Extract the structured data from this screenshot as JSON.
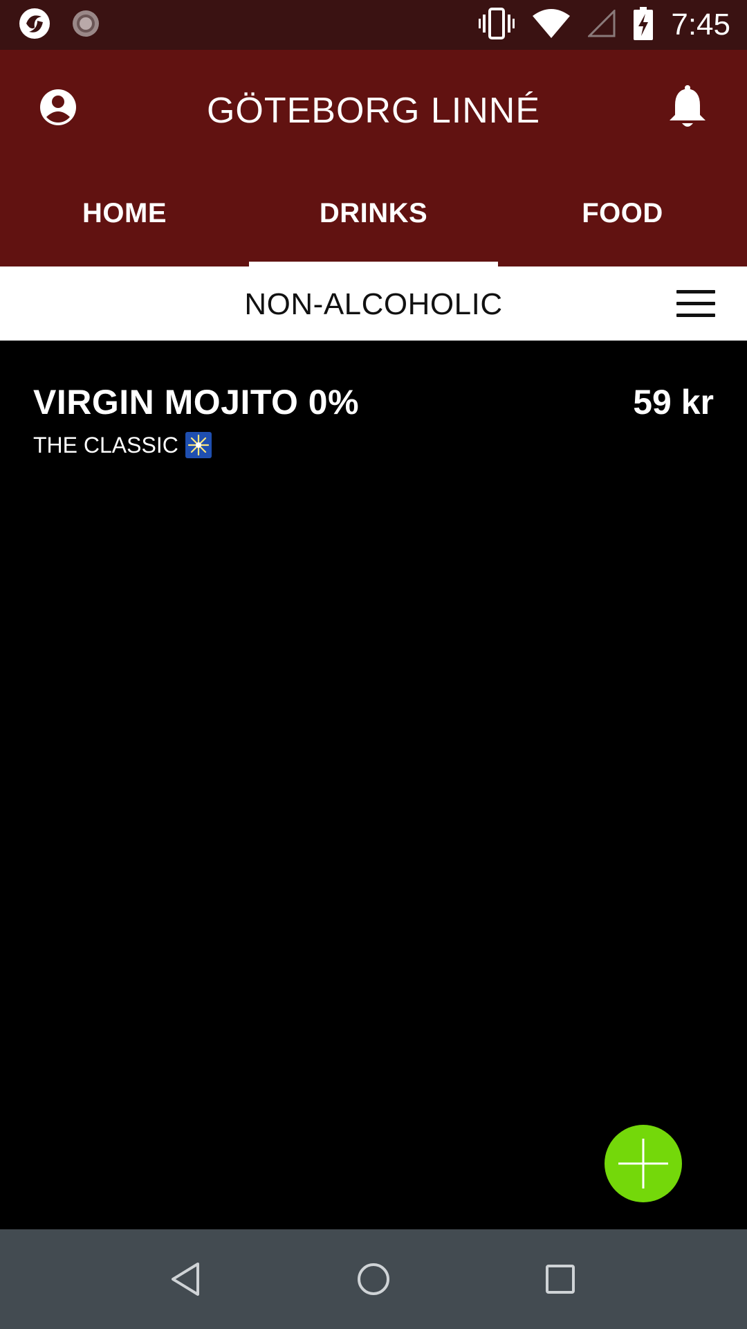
{
  "status_bar": {
    "time": "7:45",
    "icons": [
      "app-notification-icon",
      "loading-notification-icon",
      "vibrate-icon",
      "wifi-icon",
      "cell-signal-icon",
      "battery-charging-icon"
    ]
  },
  "header": {
    "venue_title": "GÖTEBORG LINNÉ",
    "profile_icon": "account-circle-icon",
    "notification_icon": "bell-icon",
    "tabs": [
      {
        "label": "HOME",
        "active": false
      },
      {
        "label": "DRINKS",
        "active": true
      },
      {
        "label": "FOOD",
        "active": false
      }
    ]
  },
  "category": {
    "title": "NON-ALCOHOLIC",
    "menu_icon": "hamburger-menu-icon"
  },
  "items": [
    {
      "name": "VIRGIN MOJITO 0%",
      "description": "THE CLASSIC",
      "badge_icon": "sparkle-icon",
      "price": "59 kr"
    }
  ],
  "fab": {
    "icon": "plus-icon"
  },
  "nav_bar": {
    "buttons": [
      "back-icon",
      "home-icon",
      "recents-icon"
    ]
  },
  "colors": {
    "status_bar": "#3a1212",
    "header": "#611211",
    "fab": "#74d80a",
    "nav_bar": "#434b51",
    "background": "#000000"
  }
}
